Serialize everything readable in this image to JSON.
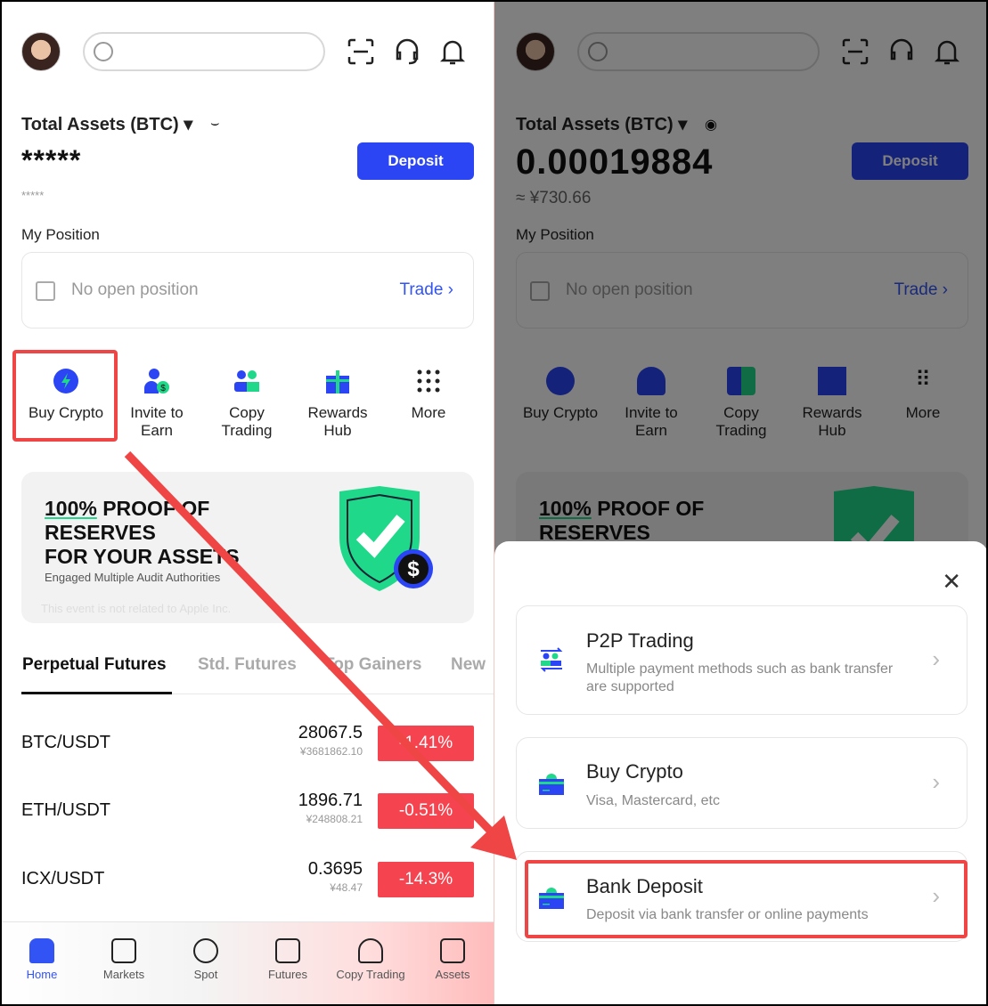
{
  "header": {
    "search_placeholder": "",
    "icons": [
      "scan-icon",
      "headset-icon",
      "bell-icon"
    ]
  },
  "assets": {
    "label": "Total Assets (BTC) ▾",
    "hidden_balance": "*****",
    "hidden_fiat": "*****",
    "balance": "0.00019884",
    "fiat": "≈ ¥730.66",
    "deposit_label": "Deposit"
  },
  "position": {
    "title": "My Position",
    "empty": "No open position",
    "trade": "Trade ›"
  },
  "shortcuts": [
    {
      "label": "Buy Crypto"
    },
    {
      "label": "Invite to Earn"
    },
    {
      "label": "Copy Trading"
    },
    {
      "label": "Rewards Hub"
    },
    {
      "label": "More"
    }
  ],
  "banner": {
    "pct": "100%",
    "line1": " PROOF OF",
    "line2": "RESERVES",
    "line3": "FOR YOUR ASSETS",
    "sub": "Engaged Multiple Audit Authorities",
    "note": "This event is not related to Apple Inc."
  },
  "tabs": [
    "Perpetual Futures",
    "Std. Futures",
    "Top Gainers",
    "New"
  ],
  "markets": [
    {
      "pair": "BTC/USDT",
      "price": "28067.5",
      "cny": "¥3681862.10",
      "change": "-1.41%"
    },
    {
      "pair": "ETH/USDT",
      "price": "1896.71",
      "cny": "¥248808.21",
      "change": "-0.51%"
    },
    {
      "pair": "ICX/USDT",
      "price": "0.3695",
      "cny": "¥48.47",
      "change": "-14.3%"
    }
  ],
  "nav": [
    "Home",
    "Markets",
    "Spot",
    "Futures",
    "Copy Trading",
    "Assets"
  ],
  "sheet": {
    "close": "✕",
    "options": [
      {
        "title": "P2P Trading",
        "desc": "Multiple payment methods such as bank transfer are supported"
      },
      {
        "title": "Buy Crypto",
        "desc": "Visa, Mastercard, etc"
      },
      {
        "title": "Bank Deposit",
        "desc": "Deposit via bank transfer or online payments"
      }
    ]
  },
  "colors": {
    "accent": "#2b45f5",
    "down": "#f5444f",
    "annotation": "#ef4545",
    "green": "#1fd88a"
  }
}
